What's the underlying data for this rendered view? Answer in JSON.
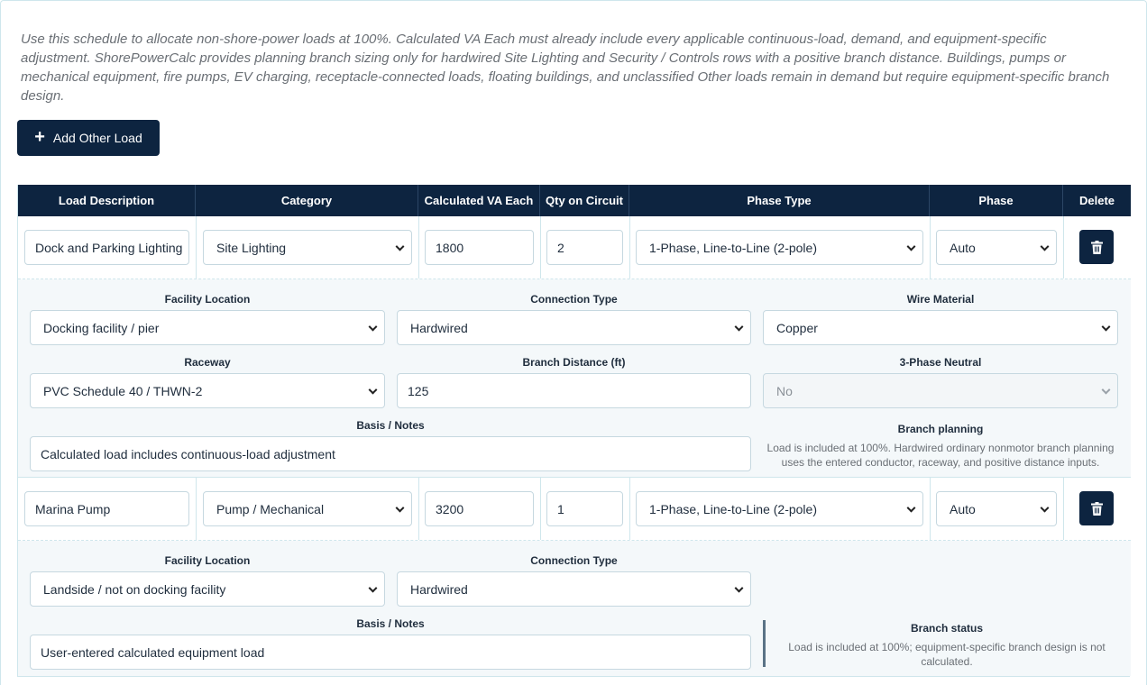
{
  "intro_text": "Use this schedule to allocate non-shore-power loads at 100%. Calculated VA Each must already include every applicable continuous-load, demand, and equipment-specific adjustment. ShorePowerCalc provides planning branch sizing only for hardwired Site Lighting and Security / Controls rows with a positive branch distance. Buildings, pumps or mechanical equipment, fire pumps, EV charging, receptacle-connected loads, floating buildings, and unclassified Other loads remain in demand but require equipment-specific branch design.",
  "add_button_label": "Add Other Load",
  "columns": [
    "Load Description",
    "Category",
    "Calculated VA Each",
    "Qty on Circuit",
    "Phase Type",
    "Phase",
    "Delete"
  ],
  "labels": {
    "facility_location": "Facility Location",
    "connection_type": "Connection Type",
    "wire_material": "Wire Material",
    "raceway": "Raceway",
    "branch_distance": "Branch Distance (ft)",
    "three_phase_neutral": "3-Phase Neutral",
    "basis_notes": "Basis / Notes"
  },
  "rows": [
    {
      "description": "Dock and Parking Lighting",
      "category": "Site Lighting",
      "va_each": "1800",
      "qty": "2",
      "phase_type": "1-Phase, Line-to-Line (2-pole)",
      "phase": "Auto",
      "facility_location": "Docking facility / pier",
      "connection_type": "Hardwired",
      "wire_material": "Copper",
      "raceway": "PVC Schedule 40 / THWN-2",
      "branch_distance": "125",
      "three_phase_neutral": "No",
      "basis_notes": "Calculated load includes continuous-load adjustment",
      "info_title": "Branch planning",
      "info_text": "Load is included at 100%. Hardwired ordinary nonmotor branch planning uses the entered conductor, raceway, and positive distance inputs."
    },
    {
      "description": "Marina Pump",
      "category": "Pump / Mechanical",
      "va_each": "3200",
      "qty": "1",
      "phase_type": "1-Phase, Line-to-Line (2-pole)",
      "phase": "Auto",
      "facility_location": "Landside / not on docking facility",
      "connection_type": "Hardwired",
      "basis_notes": "User-entered calculated equipment load",
      "info_title": "Branch status",
      "info_text": "Load is included at 100%; equipment-specific branch design is not calculated."
    }
  ],
  "icons": {
    "add": "plus-icon",
    "delete": "trash-icon",
    "dropdown": "chevron-down-icon"
  },
  "colors": {
    "header_bg": "#0d2440",
    "detail_bg": "#f4f8fa",
    "border": "#cfe6ec"
  }
}
